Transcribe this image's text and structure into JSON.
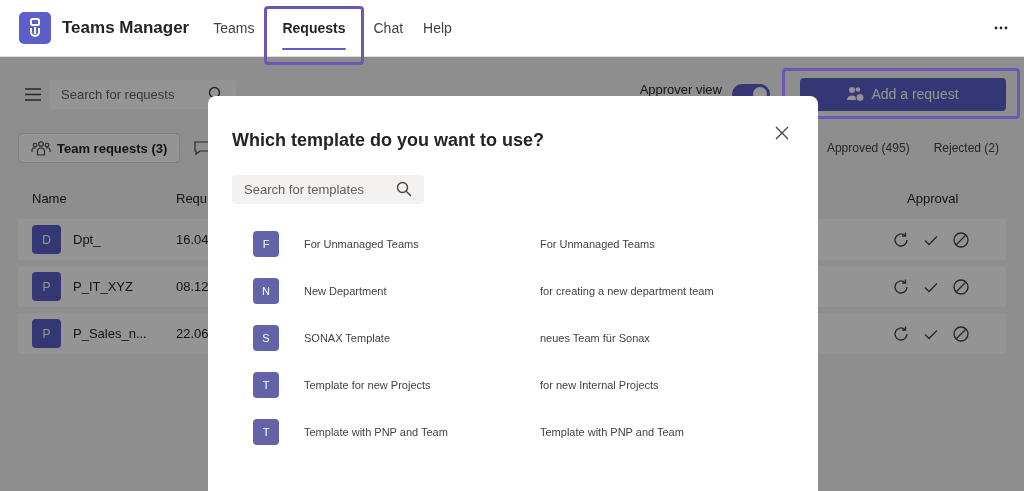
{
  "app": {
    "title": "Teams Manager"
  },
  "nav": [
    {
      "label": "Teams",
      "selected": false,
      "highlighted": false
    },
    {
      "label": "Requests",
      "selected": true,
      "highlighted": true
    },
    {
      "label": "Chat",
      "selected": false,
      "highlighted": false
    },
    {
      "label": "Help",
      "selected": false,
      "highlighted": false
    }
  ],
  "toolbar": {
    "search": {
      "placeholder": "Search for requests"
    },
    "approver_view": {
      "label": "Approver view",
      "on": true
    },
    "add_button": {
      "label": "Add a request",
      "highlighted": true
    }
  },
  "request_tabs": [
    {
      "label": "Team requests (3)",
      "selected": true
    }
  ],
  "status_tabs": [
    {
      "label": "Approved (495)",
      "selected": false
    },
    {
      "label": "Rejected (2)",
      "selected": false
    }
  ],
  "table": {
    "columns": [
      "Name",
      "Requ",
      "Approval"
    ],
    "rows": [
      {
        "initial": "D",
        "name": "Dpt_",
        "date": "16.04"
      },
      {
        "initial": "P",
        "name": "P_IT_XYZ",
        "date": "08.12"
      },
      {
        "initial": "P",
        "name": "P_Sales_n...",
        "date": "22.06"
      }
    ]
  },
  "dialog": {
    "title": "Which template do you want to use?",
    "search": {
      "placeholder": "Search for templates"
    },
    "templates": [
      {
        "initial": "F",
        "name": "For Unmanaged Teams",
        "description": "For Unmanaged Teams"
      },
      {
        "initial": "N",
        "name": "New Department",
        "description": "for creating a new department team"
      },
      {
        "initial": "S",
        "name": "SONAX Template",
        "description": "neues Team für Sonax"
      },
      {
        "initial": "T",
        "name": "Template for new Projects",
        "description": "for new Internal Projects"
      },
      {
        "initial": "T",
        "name": "Template with PNP and Team",
        "description": "Template with PNP and Team"
      }
    ]
  }
}
